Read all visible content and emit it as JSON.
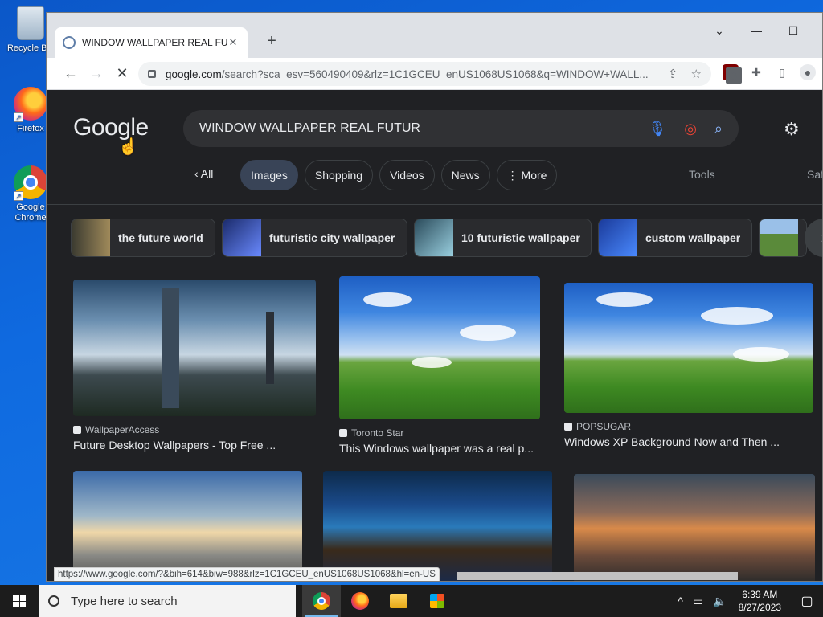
{
  "desktop": {
    "icons": [
      {
        "label": "Recycle Bin"
      },
      {
        "label": "Firefox"
      },
      {
        "label": "Google Chrome"
      }
    ]
  },
  "browser": {
    "tab_title": "WINDOW WALLPAPER REAL FUTUR",
    "new_tab": "+",
    "controls": {
      "dropdown": "⌄",
      "minimize": "—",
      "maximize": "☐",
      "close": "✕"
    },
    "url_host": "google.com",
    "url_rest": "/search?sca_esv=560490409&rlz=1C1GCEU_enUS1068US1068&q=WINDOW+WALL...",
    "extension_badge": "3",
    "status_url": "https://www.google.com/?&bih=614&biw=988&rlz=1C1GCEU_enUS1068US1068&hl=en-US"
  },
  "google": {
    "logo": "Google",
    "query": "WINDOW WALLPAPER REAL FUTUR",
    "filters": {
      "all": "All",
      "chips": [
        "Images",
        "Shopping",
        "Videos",
        "News",
        "⋮ More"
      ],
      "tools": "Tools",
      "safe": "Saf"
    },
    "related": [
      {
        "label": "the future world"
      },
      {
        "label": "futuristic city wallpaper"
      },
      {
        "label": "10 futuristic wallpaper"
      },
      {
        "label": "custom wallpaper"
      }
    ],
    "results": [
      {
        "source": "WallpaperAccess",
        "title": "Future Desktop Wallpapers - Top Free ..."
      },
      {
        "source": "Toronto Star",
        "title": "This Windows wallpaper was a real p..."
      },
      {
        "source": "POPSUGAR",
        "title": "Windows XP Background Now and Then ..."
      }
    ]
  },
  "taskbar": {
    "search_placeholder": "Type here to search",
    "time": "6:39 AM",
    "date": "8/27/2023"
  },
  "colors": {
    "page_bg": "#202124",
    "chip_active": "#394457",
    "taskbar": "#1c1c1c"
  }
}
